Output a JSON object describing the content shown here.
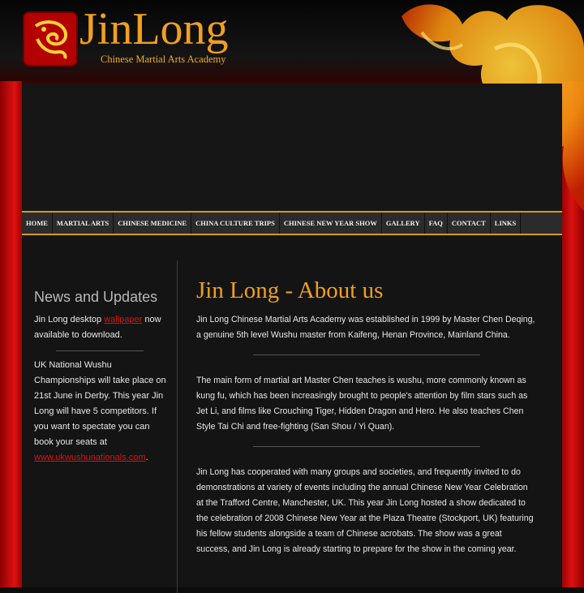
{
  "header": {
    "logo_title": "JinLong",
    "logo_subtitle": "Chinese Martial Arts Academy",
    "logo_icon": "dragon-icon"
  },
  "nav": {
    "items": [
      "HOME",
      "MARTIAL ARTS",
      "CHINESE MEDICINE",
      "CHINA CULTURE TRIPS",
      "CHINESE NEW YEAR SHOW",
      "GALLERY",
      "FAQ",
      "CONTACT",
      "LINKS"
    ]
  },
  "sidebar": {
    "title": "News and Updates",
    "item1_prefix": "Jin Long desktop ",
    "item1_link": "wallpaper",
    "item1_suffix": " now available to download.",
    "item2_text": "UK National Wushu Championships will take place on 21st June in Derby. This year Jin Long will have 5 competitors. If you want to spectate you can book your seats at",
    "item2_link": "www.ukwushunationals.com",
    "item2_suffix": "."
  },
  "main": {
    "title": "Jin Long - About us",
    "p1": "Jin Long Chinese Martial Arts Academy was established in 1999 by Master Chen Deqing, a genuine 5th level Wushu master from Kaifeng, Henan Province, Mainland China.",
    "p2": "The main form of martial art Master Chen teaches is wushu, more commonly known as kung fu, which has been increasingly brought to people's attention by film stars such as Jet Li, and films like Crouching Tiger, Hidden Dragon and Hero. He also teaches Chen Style Tai Chi and free-fighting (San Shou / Yi Quan).",
    "p3": "Jin Long has cooperated with many groups and societies, and frequently invited to do demonstrations at variety of events including the annual Chinese New Year Celebration at the Trafford Centre, Manchester, UK. This year Jin Long hosted a show dedicated to the celebration of 2008 Chinese New Year at the Plaza Theatre (Stockport, UK) featuring his fellow students alongside a team of Chinese acrobats. The show was a great success, and Jin Long is already starting to prepare for the show in the coming year."
  },
  "colors": {
    "accent": "#f0a020",
    "link": "#e01010",
    "background": "#141414",
    "side_red": "#d11111"
  }
}
